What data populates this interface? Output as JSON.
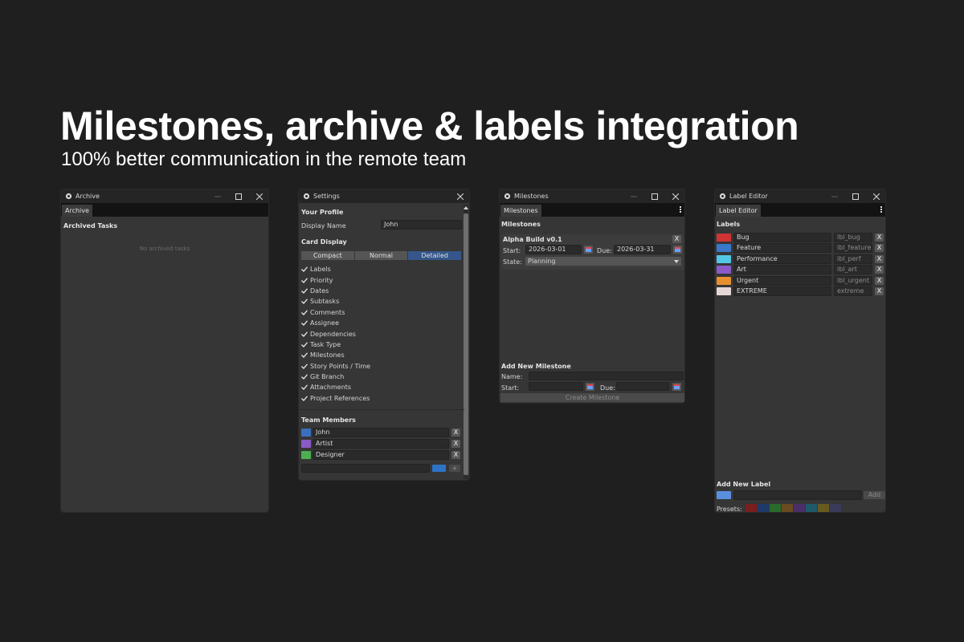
{
  "headline": "Milestones, archive & labels integration",
  "subheadline": "100% better communication in the remote team",
  "colors": {
    "background": "#1f1f1f",
    "panel": "#363636",
    "titlebar": "#252525",
    "accent_blue": "#2f73c6",
    "selected_segment": "#34568a"
  },
  "archive": {
    "window_title": "Archive",
    "tab": "Archive",
    "heading": "Archived Tasks",
    "empty_text": "No archived tasks"
  },
  "settings": {
    "window_title": "Settings",
    "profile_heading": "Your Profile",
    "display_name_label": "Display Name",
    "display_name_value": "John",
    "card_display_heading": "Card Display",
    "segments": [
      "Compact",
      "Normal",
      "Detailed"
    ],
    "selected_segment": "Detailed",
    "checkboxes": [
      {
        "label": "Labels",
        "checked": true
      },
      {
        "label": "Priority",
        "checked": true
      },
      {
        "label": "Dates",
        "checked": true
      },
      {
        "label": "Subtasks",
        "checked": true
      },
      {
        "label": "Comments",
        "checked": true
      },
      {
        "label": "Assignee",
        "checked": true
      },
      {
        "label": "Dependencies",
        "checked": true
      },
      {
        "label": "Task Type",
        "checked": true
      },
      {
        "label": "Milestones",
        "checked": true
      },
      {
        "label": "Story Points / Time",
        "checked": true
      },
      {
        "label": "Git Branch",
        "checked": true
      },
      {
        "label": "Attachments",
        "checked": true
      },
      {
        "label": "Project References",
        "checked": true
      }
    ],
    "team_heading": "Team Members",
    "members": [
      {
        "name": "John",
        "color": "#3a6fc0",
        "remove": "X"
      },
      {
        "name": "Artist",
        "color": "#8a5ac8",
        "remove": "X"
      },
      {
        "name": "Designer",
        "color": "#4caf50",
        "remove": "X"
      }
    ],
    "new_member_color": "#2f73c6",
    "add_label": "+"
  },
  "milestones": {
    "window_title": "Milestones",
    "tab": "Milestones",
    "heading": "Milestones",
    "item": {
      "name": "Alpha Build v0.1",
      "start_label": "Start:",
      "start_value": "2026-03-01",
      "due_label": "Due:",
      "due_value": "2026-03-31",
      "state_label": "State:",
      "state_value": "Planning",
      "remove": "X"
    },
    "add_heading": "Add New Milestone",
    "name_label": "Name:",
    "start_label": "Start:",
    "due_label": "Due:",
    "create_button": "Create Milestone"
  },
  "label_editor": {
    "window_title": "Label Editor",
    "tab": "Label Editor",
    "heading": "Labels",
    "labels": [
      {
        "name": "Bug",
        "id": "lbl_bug",
        "color": "#d03434",
        "remove": "X"
      },
      {
        "name": "Feature",
        "id": "lbl_feature",
        "color": "#3a78c8",
        "remove": "X"
      },
      {
        "name": "Performance",
        "id": "lbl_perf",
        "color": "#52c6e6",
        "remove": "X"
      },
      {
        "name": "Art",
        "id": "lbl_art",
        "color": "#8a5ac8",
        "remove": "X"
      },
      {
        "name": "Urgent",
        "id": "lbl_urgent",
        "color": "#e8902e",
        "remove": "X"
      },
      {
        "name": "EXTREME",
        "id": "extreme",
        "color": "#e6d6d6",
        "remove": "X"
      }
    ],
    "add_heading": "Add New Label",
    "new_label_color": "#5a8fe0",
    "add_button": "Add",
    "presets_label": "Presets:",
    "presets": [
      "#7a1e1e",
      "#1e3a6a",
      "#2a6a2a",
      "#6a4a1e",
      "#4a2e6a",
      "#1e5a6a",
      "#6a5a1e",
      "#3a3a5a"
    ]
  }
}
